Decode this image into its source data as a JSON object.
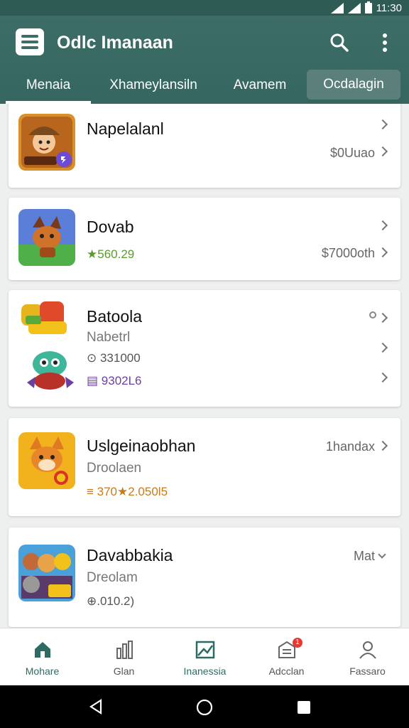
{
  "status": {
    "time": "11:30"
  },
  "app_bar": {
    "title": "Odlc Imanaan"
  },
  "tabs": [
    {
      "label": "Menaia"
    },
    {
      "label": "Xhameylansiln"
    },
    {
      "label": "Avamem"
    },
    {
      "label": "Ocdalagin"
    }
  ],
  "items": [
    {
      "name": "Napelalanl",
      "price": "$0Uuao"
    },
    {
      "name": "Dovab",
      "rating": "★560.29",
      "price": "$7000oth"
    },
    {
      "name": "Batoola",
      "sub": "Nabetrl",
      "meta1": "⊙ 331000",
      "meta2": "▤ 9302L6"
    },
    {
      "name": "Uslgeinaobhan",
      "sub": "Droolaen",
      "meta": "≡ 370★2.050l5",
      "right": "1handax"
    },
    {
      "name": "Davabbakia",
      "sub": "Dreolam",
      "meta": "⊕.010.2)",
      "right": "Mat"
    }
  ],
  "bottom_nav": [
    {
      "label": "Mohare"
    },
    {
      "label": "Glan"
    },
    {
      "label": "Inanessia"
    },
    {
      "label": "Adcclan",
      "badge": "1"
    },
    {
      "label": "Fassaro"
    }
  ],
  "colors": {
    "primary": "#3d6d66",
    "active_nav": "#2e6a64",
    "rating_green": "#5a9a2e",
    "purple": "#6b3fa0"
  }
}
